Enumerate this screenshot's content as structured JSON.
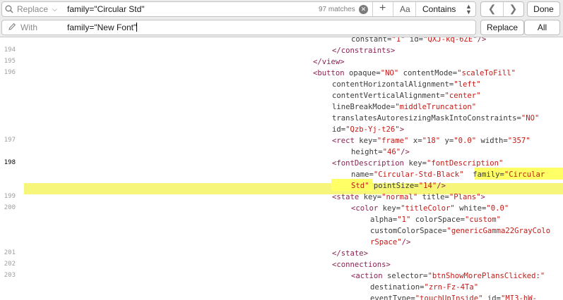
{
  "find": {
    "mode": "Replace",
    "query": "family=\"Circular Std\"",
    "match_count": "97 matches",
    "case_toggle": "Aa",
    "match_style": "Contains",
    "done": "Done"
  },
  "replace": {
    "label": "With",
    "value": "family=\"New Font\"",
    "replace_one": "Replace",
    "replace_all": "All"
  },
  "editor": {
    "current_line": "198",
    "lines": [
      {
        "num": "",
        "parts": [
          [
            "a",
            "constant="
          ],
          [
            "v",
            "\"1\""
          ],
          [
            "a",
            " id="
          ],
          [
            "v",
            "\"QXJ-kq-6ZE\""
          ],
          [
            "t",
            "/>"
          ]
        ]
      },
      {
        "num": "194",
        "parts": [
          [
            "t",
            "</constraints>"
          ]
        ]
      },
      {
        "num": "195",
        "parts": [
          [
            "t",
            "</view>"
          ]
        ]
      },
      {
        "num": "196",
        "parts": [
          [
            "t",
            "<button"
          ],
          [
            "a",
            " opaque="
          ],
          [
            "v",
            "\"NO\""
          ],
          [
            "a",
            " contentMode="
          ],
          [
            "v",
            "\"scaleToFill\""
          ]
        ]
      },
      {
        "num": "",
        "parts": [
          [
            "a",
            "contentHorizontalAlignment="
          ],
          [
            "v",
            "\"left\""
          ]
        ]
      },
      {
        "num": "",
        "parts": [
          [
            "a",
            "contentVerticalAlignment="
          ],
          [
            "v",
            "\"center\""
          ]
        ]
      },
      {
        "num": "",
        "parts": [
          [
            "a",
            "lineBreakMode="
          ],
          [
            "v",
            "\"middleTruncation\""
          ]
        ]
      },
      {
        "num": "",
        "parts": [
          [
            "a",
            "translatesAutoresizingMaskIntoConstraints="
          ],
          [
            "v",
            "\"NO\""
          ]
        ]
      },
      {
        "num": "",
        "parts": [
          [
            "a",
            "id="
          ],
          [
            "v",
            "\"Qzb-Yj-t26\""
          ],
          [
            "t",
            ">"
          ]
        ]
      },
      {
        "num": "197",
        "parts": [
          [
            "t",
            "<rect"
          ],
          [
            "a",
            " key="
          ],
          [
            "v",
            "\"frame\""
          ],
          [
            "a",
            " x="
          ],
          [
            "v",
            "\"18\""
          ],
          [
            "a",
            " y="
          ],
          [
            "v",
            "\"0.0\""
          ],
          [
            "a",
            " width="
          ],
          [
            "v",
            "\"357\""
          ]
        ]
      },
      {
        "num": "",
        "parts": [
          [
            "a",
            "height="
          ],
          [
            "v",
            "\"46\""
          ],
          [
            "t",
            "/>"
          ]
        ]
      },
      {
        "num": "198",
        "parts": [
          [
            "t",
            "<fontDescription"
          ],
          [
            "a",
            " key="
          ],
          [
            "v",
            "\"fontDescription\""
          ]
        ]
      },
      {
        "num": "",
        "parts": [
          [
            "a",
            "name="
          ],
          [
            "v",
            "\"Circular-Std-Black\""
          ],
          [
            "a",
            "  "
          ],
          [
            "a",
            "family="
          ],
          [
            "v",
            "\"Circular"
          ]
        ]
      },
      {
        "num": "",
        "parts": [
          [
            "v",
            "Std\""
          ],
          [
            "a",
            " pointSize="
          ],
          [
            "v",
            "\"14\""
          ],
          [
            "t",
            "/>"
          ]
        ]
      },
      {
        "num": "199",
        "parts": [
          [
            "t",
            "<state"
          ],
          [
            "a",
            " key="
          ],
          [
            "v",
            "\"normal\""
          ],
          [
            "a",
            " title="
          ],
          [
            "v",
            "\"Plans\""
          ],
          [
            "t",
            ">"
          ]
        ]
      },
      {
        "num": "200",
        "parts": [
          [
            "t",
            "<color"
          ],
          [
            "a",
            " key="
          ],
          [
            "v",
            "\"titleColor\""
          ],
          [
            "a",
            " white="
          ],
          [
            "v",
            "\"0.0\""
          ]
        ]
      },
      {
        "num": "",
        "parts": [
          [
            "a",
            "alpha="
          ],
          [
            "v",
            "\"1\""
          ],
          [
            "a",
            " colorSpace="
          ],
          [
            "v",
            "\"custom\""
          ]
        ]
      },
      {
        "num": "",
        "parts": [
          [
            "a",
            "customColorSpace="
          ],
          [
            "v",
            "\"genericGamma22GrayColo"
          ]
        ]
      },
      {
        "num": "",
        "parts": [
          [
            "v",
            "rSpace\""
          ],
          [
            "t",
            "/>"
          ]
        ]
      },
      {
        "num": "201",
        "parts": [
          [
            "t",
            "</state>"
          ]
        ]
      },
      {
        "num": "202",
        "parts": [
          [
            "t",
            "<connections>"
          ]
        ]
      },
      {
        "num": "203",
        "parts": [
          [
            "t",
            "<action"
          ],
          [
            "a",
            " selector="
          ],
          [
            "v",
            "\"btnShowMorePlansClicked:\""
          ]
        ]
      },
      {
        "num": "",
        "parts": [
          [
            "a",
            "destination="
          ],
          [
            "v",
            "\"zrn-Fz-4Ta\""
          ]
        ]
      },
      {
        "num": "",
        "parts": [
          [
            "a",
            "eventType="
          ],
          [
            "v",
            "\"touchUpInside\""
          ],
          [
            "a",
            " id="
          ],
          [
            "v",
            "\"MI3-hW-"
          ]
        ]
      }
    ]
  },
  "colors": {
    "tag": "#8b2252",
    "attr": "#3a3a3a",
    "value": "#c41a16",
    "highlight": "#ffff66"
  }
}
